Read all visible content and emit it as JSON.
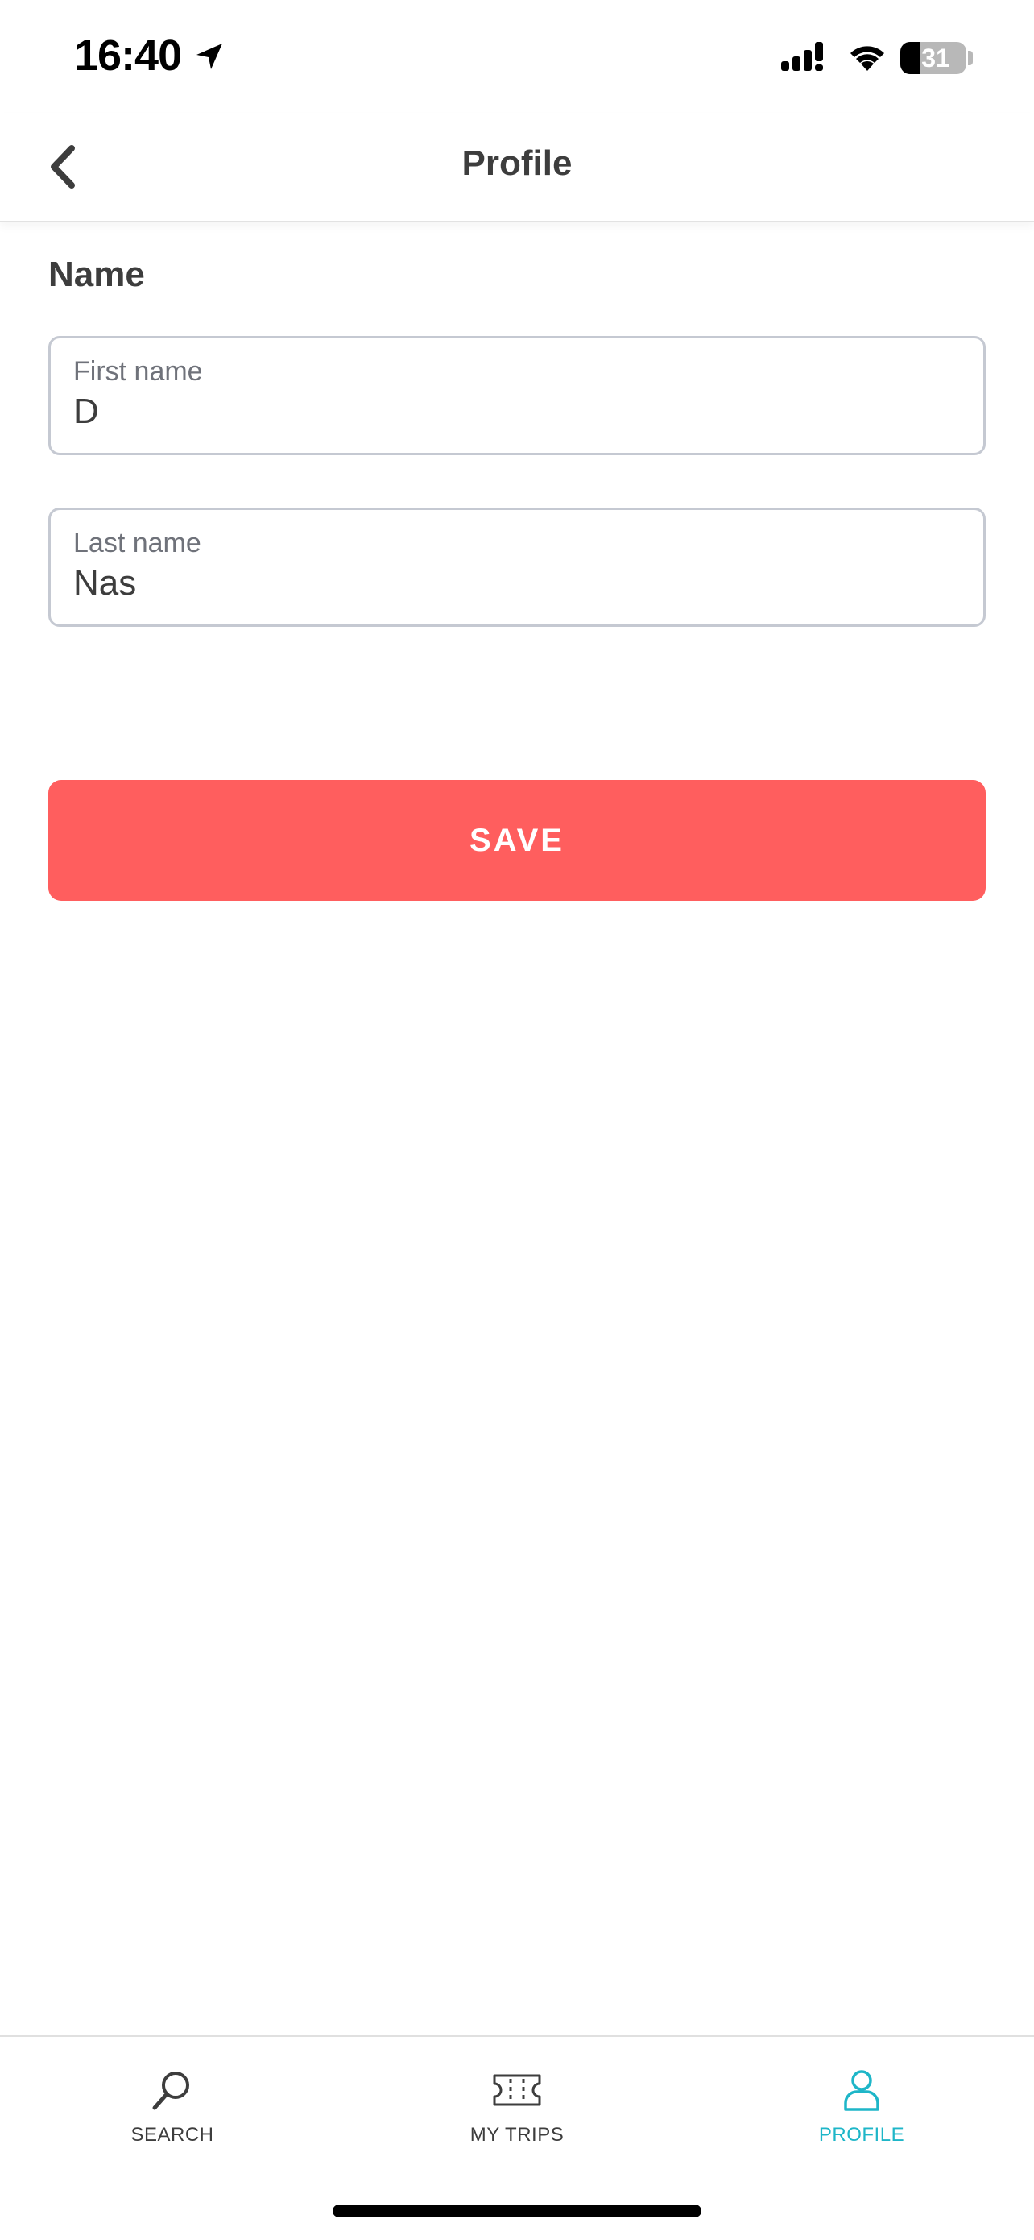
{
  "status_bar": {
    "time": "16:40",
    "battery_level": "31",
    "battery_fraction": 0.31,
    "icons": [
      "location-arrow-icon",
      "signal-icon",
      "wifi-icon",
      "battery-icon"
    ]
  },
  "header": {
    "title": "Profile",
    "back_icon": "chevron-left-icon"
  },
  "form": {
    "section_title": "Name",
    "first_name": {
      "label": "First name",
      "value": "D"
    },
    "last_name": {
      "label": "Last name",
      "value": "Nas"
    },
    "save_label": "SAVE"
  },
  "tab_bar": {
    "tabs": [
      {
        "label": "SEARCH",
        "icon": "search-icon",
        "active": false
      },
      {
        "label": "MY TRIPS",
        "icon": "ticket-icon",
        "active": false
      },
      {
        "label": "PROFILE",
        "icon": "person-icon",
        "active": true
      }
    ]
  },
  "colors": {
    "accent": "#ff5e5e",
    "active_tab": "#1eb6c8",
    "text": "#3d3d3d",
    "field_border": "#c5c9d2",
    "label": "#6f727a"
  }
}
